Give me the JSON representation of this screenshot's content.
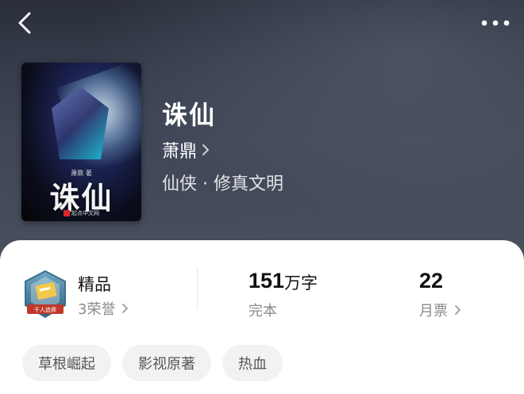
{
  "nav": {
    "back_icon": "chevron-left-icon",
    "more_icon": "more-horizontal-icon"
  },
  "book": {
    "title": "诛仙",
    "author": "萧鼎",
    "genre": "仙侠 · 修真文明",
    "cover": {
      "author_text": "萧鼎 著",
      "title_text": "诛仙",
      "publisher_text": "起点中文网"
    }
  },
  "stats": {
    "badge": {
      "title": "精品",
      "honors": "3荣誉",
      "emblem_text": "千人追捧",
      "icon": "quality-badge-icon"
    },
    "words": {
      "value": "151",
      "unit": "万字",
      "status": "完本"
    },
    "votes": {
      "value": "22",
      "label": "月票"
    }
  },
  "tags": [
    "草根崛起",
    "影视原著",
    "热血"
  ],
  "colors": {
    "card_bg": "#ffffff",
    "tag_bg": "#f2f2f4",
    "secondary_text": "#8a8a8a"
  }
}
